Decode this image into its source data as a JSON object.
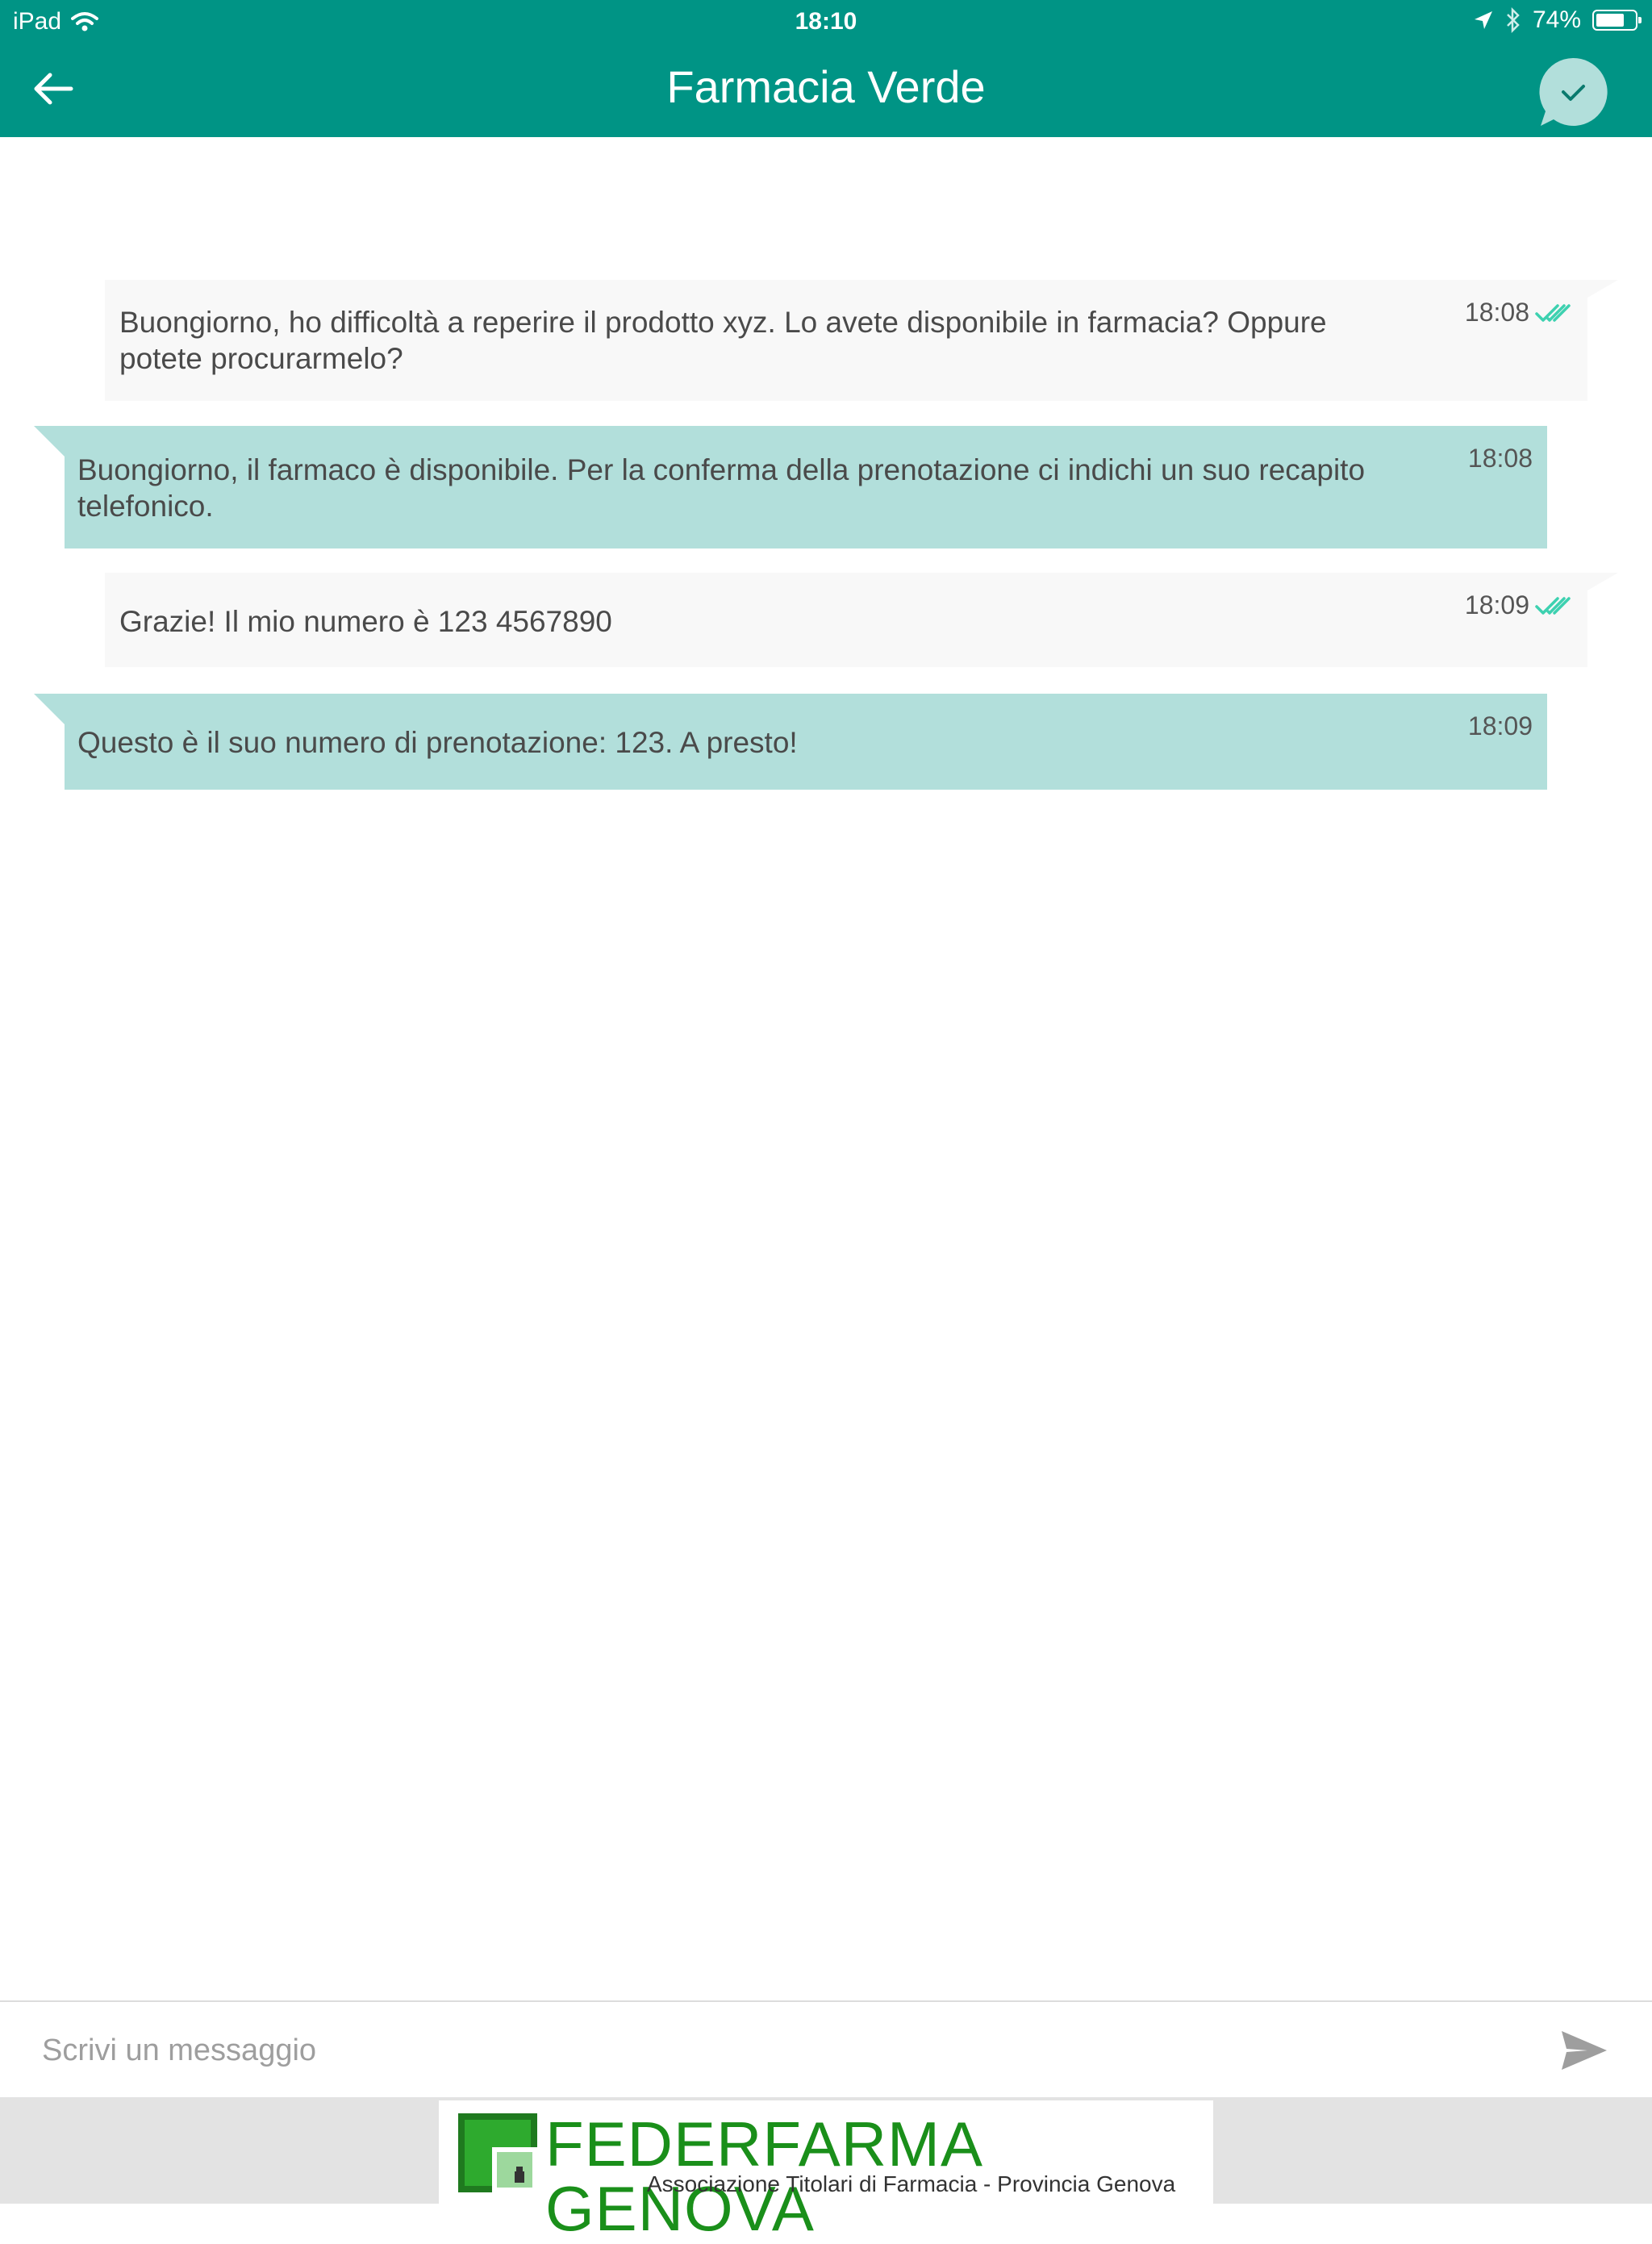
{
  "status_bar": {
    "device": "iPad",
    "time": "18:10",
    "battery": "74%",
    "battery_level": 0.74
  },
  "header": {
    "title": "Farmacia Verde",
    "back_icon": "arrow-left-icon",
    "status_icon": "chat-check-icon"
  },
  "messages": [
    {
      "direction": "outgoing",
      "text": "Buongiorno, ho difficoltà a reperire il prodotto xyz. Lo avete disponibile in farmacia? Oppure potete procurarmelo?",
      "time": "18:08",
      "read": true
    },
    {
      "direction": "incoming",
      "text": "Buongiorno, il farmaco è disponibile. Per la conferma della prenotazione ci indichi un suo recapito telefonico.",
      "time": "18:08"
    },
    {
      "direction": "outgoing",
      "text": "Grazie! Il mio numero è 123 4567890",
      "time": "18:09",
      "read": true
    },
    {
      "direction": "incoming",
      "text": "Questo è il suo numero di prenotazione: 123. A presto!",
      "time": "18:09"
    }
  ],
  "composer": {
    "placeholder": "Scrivi un messaggio",
    "value": "",
    "send_icon": "send-icon"
  },
  "footer": {
    "brand": "FEDERFARMA GENOVA",
    "subtitle": "Associazione Titolari di Farmacia - Provincia Genova"
  },
  "colors": {
    "primary": "#009485",
    "incoming_bubble": "#b2dfdb",
    "outgoing_bubble": "#f8f8f8",
    "read_check": "#3dd1b0",
    "brand_green": "#1a8f1a"
  }
}
